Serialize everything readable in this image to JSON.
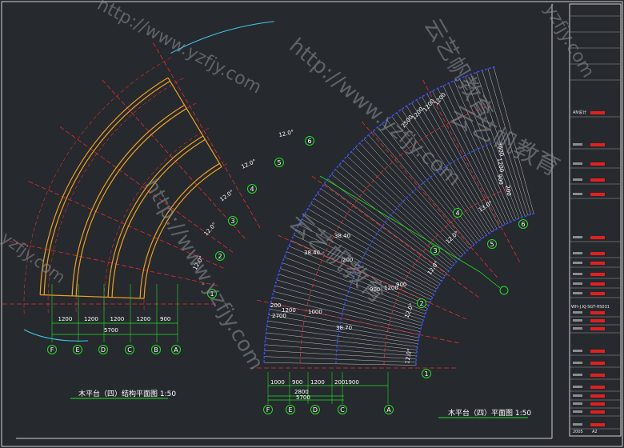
{
  "plans": {
    "left": {
      "title": "木平台（四）结构平面图 1:50",
      "axes": [
        "F",
        "E",
        "D",
        "C",
        "B",
        "A"
      ],
      "radials": [
        "1",
        "2",
        "3",
        "4",
        "5",
        "6"
      ],
      "dims_bottom": [
        "1200",
        "1200",
        "1200",
        "1200",
        "900"
      ],
      "dims_total": "5700",
      "angles": [
        "12.0°",
        "12.0°",
        "12.0°",
        "12.0°",
        "12.0°"
      ]
    },
    "right": {
      "title": "木平台（四）平面图 1:50",
      "axes": [
        "F",
        "E",
        "D",
        "C",
        "A"
      ],
      "radials": [
        "1",
        "2",
        "3",
        "4",
        "5",
        "6"
      ],
      "dims_bottom": [
        "1000",
        "900",
        "1200",
        "200",
        "1900"
      ],
      "dims_mid": [
        "2800",
        "5700"
      ],
      "dims_top": [
        "2500",
        "1200",
        "1200",
        "1200"
      ],
      "dims_side": [
        "3600",
        "1200",
        "900",
        "200"
      ],
      "dims_inner": [
        "200",
        "1200",
        "2700",
        "1000",
        "900",
        "1200",
        "900",
        "200"
      ],
      "angles": [
        "12.0°",
        "12.0°",
        "12.0°",
        "12.0°",
        "13.0°"
      ],
      "levels": [
        "38.40",
        "38.40",
        "38.70"
      ]
    }
  },
  "title_block": {
    "rows": [
      "AN设计",
      "",
      "",
      "",
      "",
      "",
      "",
      "",
      "",
      "",
      "",
      "",
      "",
      "",
      "",
      "",
      "",
      "",
      "",
      "",
      "",
      ""
    ],
    "drawing_no": "WH-J.KJ-SGT-HS031",
    "date": "2005",
    "sheet": "A2"
  },
  "watermarks": [
    "http://www.yzfjy.com",
    "云艺帆教育",
    "http://www.yzfjy.com",
    "云艺帆教育",
    "yzfjy.com",
    "yzfjy.com",
    "http://www.yzfjy.com",
    "云艺帆教育"
  ],
  "colors": {
    "background": "#26292e",
    "deck_beam": "#f0a020",
    "grid_red": "#e03030",
    "dim_green": "#20e020",
    "plank_white": "#d8d8d8",
    "edge_blue": "#3a50ff",
    "cyan": "#40c8e8",
    "title_block_red": "#e02020"
  }
}
